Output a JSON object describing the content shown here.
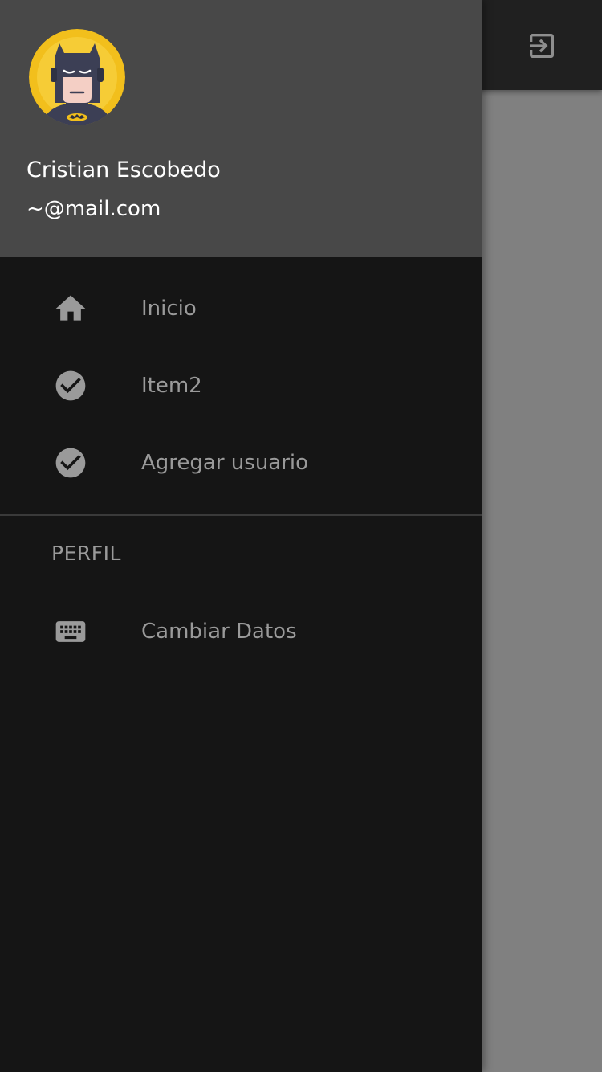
{
  "app": {
    "toolbar": {
      "action_icon": "exit-to-app-icon"
    }
  },
  "drawer": {
    "header": {
      "avatar_icon": "batman-avatar-icon",
      "name": "Cristian Escobedo",
      "email": "~@mail.com"
    },
    "items": [
      {
        "label": "Inicio",
        "icon": "home-icon"
      },
      {
        "label": "Item2",
        "icon": "check-circle-icon"
      },
      {
        "label": "Agregar usuario",
        "icon": "check-circle-icon"
      }
    ],
    "section": {
      "title": "PERFIL",
      "items": [
        {
          "label": "Cambiar Datos",
          "icon": "keyboard-icon"
        }
      ]
    }
  },
  "colors": {
    "drawer_bg": "#151515",
    "header_bg": "#484848",
    "appbar_bg": "#202020",
    "scrim": "#808080",
    "muted_text": "#9a9a9a"
  }
}
